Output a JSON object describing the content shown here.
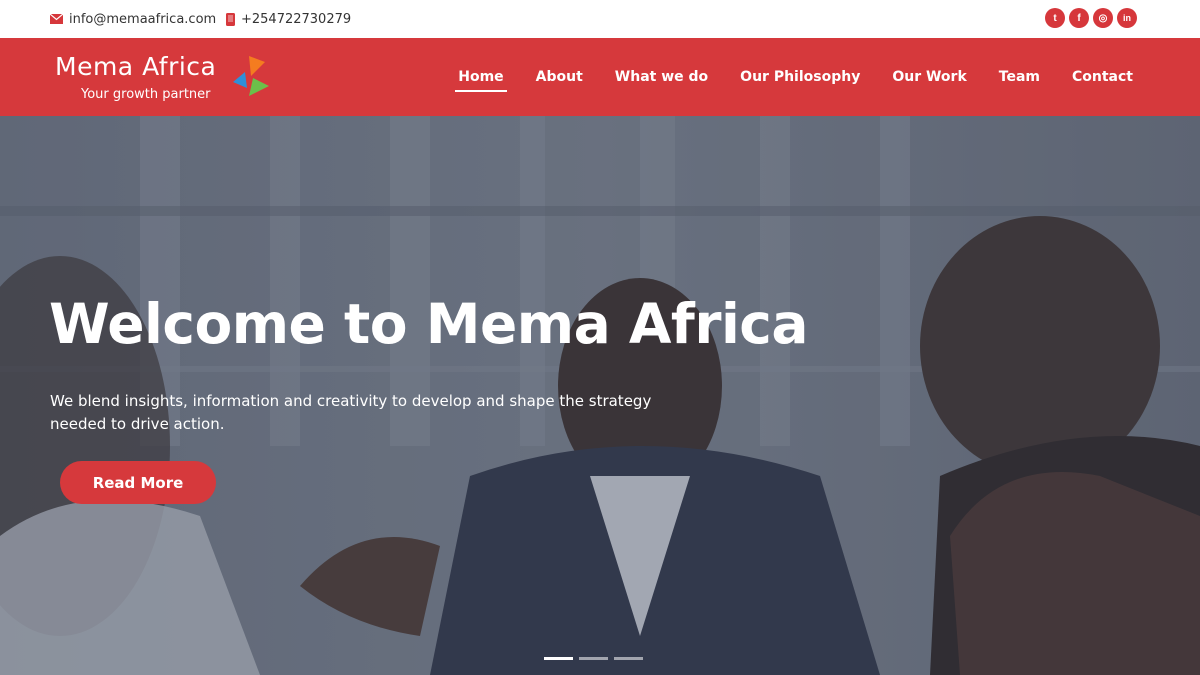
{
  "topbar": {
    "email": "info@memaafrica.com",
    "phone": "+254722730279",
    "icons": {
      "email": "envelope-icon",
      "phone": "mobile-phone-icon"
    },
    "socials": [
      {
        "name": "twitter-icon",
        "glyph": "t"
      },
      {
        "name": "facebook-icon",
        "glyph": "f"
      },
      {
        "name": "instagram-icon",
        "glyph": "◎"
      },
      {
        "name": "linkedin-icon",
        "glyph": "in"
      }
    ]
  },
  "brand": {
    "name": "Mema Africa",
    "tagline": "Your growth partner",
    "colors": {
      "primary": "#d6393c",
      "orange": "#f47c20",
      "blue": "#2f8fd8",
      "green": "#6cc04a"
    }
  },
  "nav": {
    "items": [
      "Home",
      "About",
      "What we do",
      "Our Philosophy",
      "Our Work",
      "Team",
      "Contact"
    ],
    "active": "Home"
  },
  "hero": {
    "title": "Welcome to Mema Africa",
    "text": "We blend insights, information and creativity to develop and shape the strategy needed to drive action.",
    "button": "Read More",
    "slides": 3,
    "active_slide": 1
  }
}
